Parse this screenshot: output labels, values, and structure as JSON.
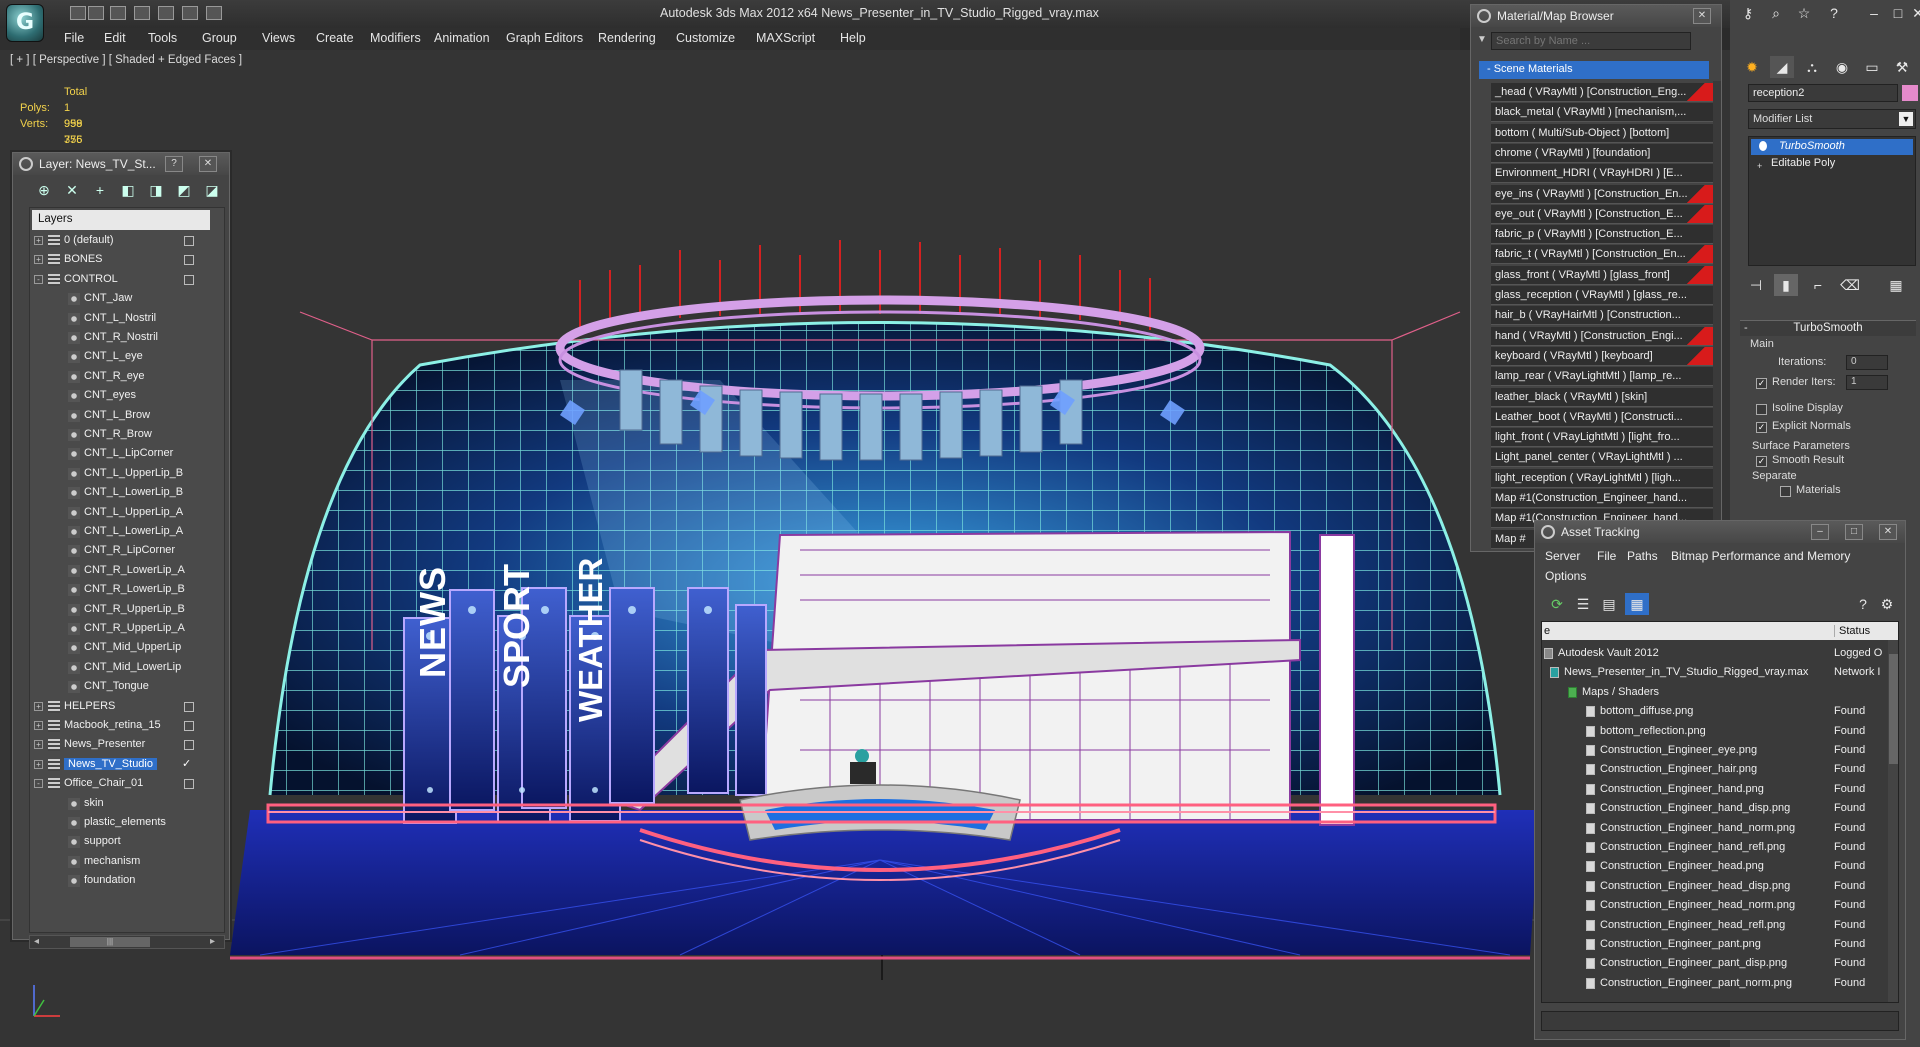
{
  "window": {
    "title": "Autodesk 3ds Max  2012 x64      News_Presenter_in_TV_Studio_Rigged_vray.max",
    "logo_letter": "G"
  },
  "menu": [
    "File",
    "Edit",
    "Tools",
    "Group",
    "Views",
    "Create",
    "Modifiers",
    "Animation",
    "Graph Editors",
    "Rendering",
    "Customize",
    "MAXScript",
    "Help"
  ],
  "viewport": {
    "label": "[ + ] [ Perspective ] [ Shaded + Edged Faces ]",
    "stats": {
      "total_label": "Total",
      "polys_label": "Polys:",
      "polys_value": "1 959 755",
      "verts_label": "Verts:",
      "verts_value": "998 376"
    },
    "wall_words": [
      "NEWS",
      "SPORT",
      "WEATHER"
    ],
    "colors": {
      "background": "#343434",
      "floor": "#1a2aa8",
      "wireframe": "#8cf0e6",
      "stage_wire": "#e05080",
      "ring": "#d4a0e8"
    }
  },
  "layer_panel": {
    "title": "Layer: News_TV_St...",
    "help_btn": "?",
    "header": "Layers",
    "tool_icons": [
      "new-layer-icon",
      "delete-icon",
      "add-icon",
      "select-icon",
      "highlight-icon",
      "hide-icon",
      "freeze-icon"
    ],
    "rows": [
      {
        "name": "0 (default)",
        "level": 0,
        "type": "layer",
        "checkbox": true
      },
      {
        "name": "BONES",
        "level": 0,
        "type": "layer",
        "checkbox": true
      },
      {
        "name": "CONTROL",
        "level": 0,
        "type": "layer",
        "checkbox": true,
        "expanded": true
      },
      {
        "name": "CNT_Jaw",
        "level": 1,
        "type": "object"
      },
      {
        "name": "CNT_L_Nostril",
        "level": 1,
        "type": "object"
      },
      {
        "name": "CNT_R_Nostril",
        "level": 1,
        "type": "object"
      },
      {
        "name": "CNT_L_eye",
        "level": 1,
        "type": "object"
      },
      {
        "name": "CNT_R_eye",
        "level": 1,
        "type": "object"
      },
      {
        "name": "CNT_eyes",
        "level": 1,
        "type": "object"
      },
      {
        "name": "CNT_L_Brow",
        "level": 1,
        "type": "object"
      },
      {
        "name": "CNT_R_Brow",
        "level": 1,
        "type": "object"
      },
      {
        "name": "CNT_L_LipCorner",
        "level": 1,
        "type": "object"
      },
      {
        "name": "CNT_L_UpperLip_B",
        "level": 1,
        "type": "object"
      },
      {
        "name": "CNT_L_LowerLip_B",
        "level": 1,
        "type": "object"
      },
      {
        "name": "CNT_L_UpperLip_A",
        "level": 1,
        "type": "object"
      },
      {
        "name": "CNT_L_LowerLip_A",
        "level": 1,
        "type": "object"
      },
      {
        "name": "CNT_R_LipCorner",
        "level": 1,
        "type": "object"
      },
      {
        "name": "CNT_R_LowerLip_A",
        "level": 1,
        "type": "object"
      },
      {
        "name": "CNT_R_LowerLip_B",
        "level": 1,
        "type": "object"
      },
      {
        "name": "CNT_R_UpperLip_B",
        "level": 1,
        "type": "object"
      },
      {
        "name": "CNT_R_UpperLip_A",
        "level": 1,
        "type": "object"
      },
      {
        "name": "CNT_Mid_UpperLip",
        "level": 1,
        "type": "object"
      },
      {
        "name": "CNT_Mid_LowerLip",
        "level": 1,
        "type": "object"
      },
      {
        "name": "CNT_Tongue",
        "level": 1,
        "type": "object"
      },
      {
        "name": "HELPERS",
        "level": 0,
        "type": "layer",
        "checkbox": true
      },
      {
        "name": "Macbook_retina_15",
        "level": 0,
        "type": "layer",
        "checkbox": true
      },
      {
        "name": "News_Presenter",
        "level": 0,
        "type": "layer",
        "checkbox": true
      },
      {
        "name": "News_TV_Studio",
        "level": 0,
        "type": "layer",
        "selected": true,
        "current": true
      },
      {
        "name": "Office_Chair_01",
        "level": 0,
        "type": "layer",
        "checkbox": true,
        "expanded": true
      },
      {
        "name": "skin",
        "level": 1,
        "type": "object"
      },
      {
        "name": "plastic_elements",
        "level": 1,
        "type": "object"
      },
      {
        "name": "support",
        "level": 1,
        "type": "object"
      },
      {
        "name": "mechanism",
        "level": 1,
        "type": "object"
      },
      {
        "name": "foundation",
        "level": 1,
        "type": "object"
      }
    ],
    "scroll_grip": "|||"
  },
  "material_browser": {
    "title": "Material/Map Browser",
    "search_placeholder": "Search by Name ...",
    "group": "- Scene Materials",
    "items": [
      {
        "label": "_head  ( VRayMtl ) [Construction_Eng...",
        "red": true
      },
      {
        "label": "black_metal  ( VRayMtl ) [mechanism,...",
        "red": false
      },
      {
        "label": "bottom  ( Multi/Sub-Object ) [bottom]",
        "red": false
      },
      {
        "label": "chrome  ( VRayMtl ) [foundation]",
        "red": false
      },
      {
        "label": "Environment_HDRI  ( VRayHDRI ) [E...",
        "red": false
      },
      {
        "label": "eye_ins  ( VRayMtl ) [Construction_En...",
        "red": true
      },
      {
        "label": "eye_out  ( VRayMtl ) [Construction_E...",
        "red": true
      },
      {
        "label": "fabric_p  ( VRayMtl ) [Construction_E...",
        "red": false
      },
      {
        "label": "fabric_t  ( VRayMtl ) [Construction_En...",
        "red": true
      },
      {
        "label": "glass_front  ( VRayMtl ) [glass_front]",
        "red": true
      },
      {
        "label": "glass_reception  ( VRayMtl ) [glass_re...",
        "red": false
      },
      {
        "label": "hair_b  ( VRayHairMtl ) [Construction...",
        "red": false
      },
      {
        "label": "hand  ( VRayMtl ) [Construction_Engi...",
        "red": true
      },
      {
        "label": "keyboard  ( VRayMtl ) [keyboard]",
        "red": true
      },
      {
        "label": "lamp_rear  ( VRayLightMtl ) [lamp_re...",
        "red": false
      },
      {
        "label": "leather_black  ( VRayMtl ) [skin]",
        "red": false
      },
      {
        "label": "Leather_boot  ( VRayMtl ) [Constructi...",
        "red": false
      },
      {
        "label": "light_front  ( VRayLightMtl ) [light_fro...",
        "red": false
      },
      {
        "label": "Light_panel_center  ( VRayLightMtl ) ...",
        "red": false
      },
      {
        "label": "light_reception  ( VRayLightMtl ) [ligh...",
        "red": false
      },
      {
        "label": "Map #1(Construction_Engineer_hand...",
        "red": false
      },
      {
        "label": "Map #1(Construction_Engineer_hand...",
        "red": false
      },
      {
        "label": "Map #",
        "red": false
      }
    ]
  },
  "command_panel": {
    "object_name": "reception2",
    "object_color": "#e58acb",
    "modifier_list": "Modifier List",
    "stack": [
      "TurboSmooth",
      "Editable Poly"
    ],
    "rollout_title": "TurboSmooth",
    "main_label": "Main",
    "iterations_label": "Iterations:",
    "iterations_value": "0",
    "render_iters_label": "Render Iters:",
    "render_iters_value": "1",
    "render_iters_checked": true,
    "isoline_label": "Isoline Display",
    "isoline_checked": false,
    "explicit_label": "Explicit Normals",
    "explicit_checked": true,
    "surface_label": "Surface Parameters",
    "smooth_label": "Smooth Result",
    "smooth_checked": true,
    "separate_label": "Separate",
    "materials_label": "Materials",
    "materials_checked": false
  },
  "asset_tracking": {
    "title": "Asset Tracking",
    "menu": [
      "Server",
      "File",
      "Paths",
      "Bitmap Performance and Memory",
      "Options"
    ],
    "col_name": "e",
    "col_status": "Status",
    "rows": [
      {
        "name": "Autodesk Vault 2012",
        "status": "Logged O",
        "indent": 0,
        "kind": "vault"
      },
      {
        "name": "News_Presenter_in_TV_Studio_Rigged_vray.max",
        "status": "Network I",
        "indent": 1,
        "kind": "max"
      },
      {
        "name": "Maps / Shaders",
        "status": "",
        "indent": 2,
        "kind": "folder"
      },
      {
        "name": "bottom_diffuse.png",
        "status": "Found",
        "indent": 3,
        "kind": "file"
      },
      {
        "name": "bottom_reflection.png",
        "status": "Found",
        "indent": 3,
        "kind": "file"
      },
      {
        "name": "Construction_Engineer_eye.png",
        "status": "Found",
        "indent": 3,
        "kind": "file"
      },
      {
        "name": "Construction_Engineer_hair.png",
        "status": "Found",
        "indent": 3,
        "kind": "file"
      },
      {
        "name": "Construction_Engineer_hand.png",
        "status": "Found",
        "indent": 3,
        "kind": "file"
      },
      {
        "name": "Construction_Engineer_hand_disp.png",
        "status": "Found",
        "indent": 3,
        "kind": "file"
      },
      {
        "name": "Construction_Engineer_hand_norm.png",
        "status": "Found",
        "indent": 3,
        "kind": "file"
      },
      {
        "name": "Construction_Engineer_hand_refl.png",
        "status": "Found",
        "indent": 3,
        "kind": "file"
      },
      {
        "name": "Construction_Engineer_head.png",
        "status": "Found",
        "indent": 3,
        "kind": "file"
      },
      {
        "name": "Construction_Engineer_head_disp.png",
        "status": "Found",
        "indent": 3,
        "kind": "file"
      },
      {
        "name": "Construction_Engineer_head_norm.png",
        "status": "Found",
        "indent": 3,
        "kind": "file"
      },
      {
        "name": "Construction_Engineer_head_refl.png",
        "status": "Found",
        "indent": 3,
        "kind": "file"
      },
      {
        "name": "Construction_Engineer_pant.png",
        "status": "Found",
        "indent": 3,
        "kind": "file"
      },
      {
        "name": "Construction_Engineer_pant_disp.png",
        "status": "Found",
        "indent": 3,
        "kind": "file"
      },
      {
        "name": "Construction_Engineer_pant_norm.png",
        "status": "Found",
        "indent": 3,
        "kind": "file"
      }
    ]
  }
}
